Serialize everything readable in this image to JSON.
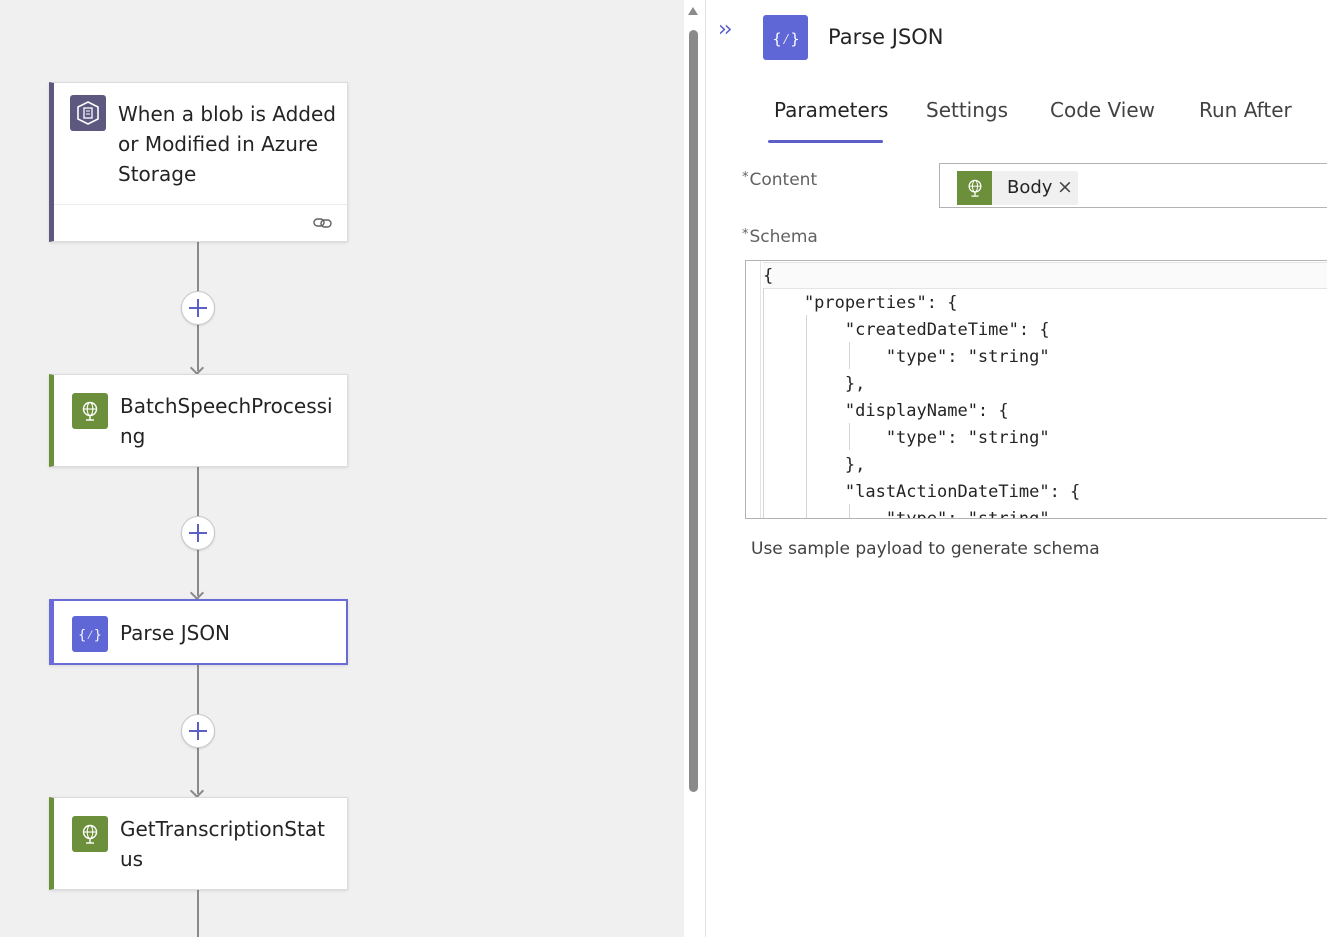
{
  "workflow": {
    "steps": [
      {
        "title": "When a blob is Added or Modified in Azure Storage",
        "kind": "trigger"
      },
      {
        "title": "BatchSpeechProcessing",
        "kind": "action"
      },
      {
        "title": "Parse JSON",
        "kind": "action",
        "selected": true
      },
      {
        "title": "GetTranscriptionStatus",
        "kind": "action"
      }
    ],
    "icons": {
      "trigger": "azure-blob-storage-icon",
      "connector": "custom-connector-globe-icon",
      "parse_json": "parse-json-braces-icon",
      "link": "link-icon",
      "add": "plus-icon"
    }
  },
  "panel": {
    "collapse_label": "››",
    "title": "Parse JSON",
    "tabs": [
      "Parameters",
      "Settings",
      "Code View",
      "Run After"
    ],
    "active_tab": "Parameters",
    "content_label": "Content",
    "content_token": "Body",
    "content_token_remove": "×",
    "schema_label": "Schema",
    "required_marker": "*",
    "schema_lines": [
      "{",
      "    \"properties\": {",
      "        \"createdDateTime\": {",
      "            \"type\": \"string\"",
      "        },",
      "        \"displayName\": {",
      "            \"type\": \"string\"",
      "        },",
      "        \"lastActionDateTime\": {",
      "            \"type\": \"string\""
    ],
    "sample_payload_link": "Use sample payload to generate schema"
  },
  "colors": {
    "accent": "#5b5fc7",
    "connector_green": "#6b8f3b",
    "trigger_purple": "#5c5880",
    "parse_json_purple": "#5f66d6"
  }
}
